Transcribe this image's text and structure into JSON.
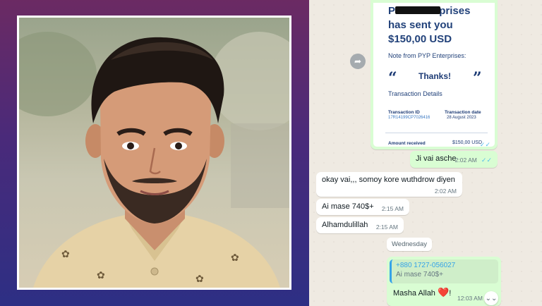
{
  "receipt": {
    "head_line1": "PYP Enterprises",
    "head_line2": "has sent you",
    "head_line3": "$150,00 USD",
    "note_label": "Note from PYP Enterprises:",
    "quote_open": "“",
    "quote_close": "”",
    "note_text": "Thanks!",
    "details_label": "Transaction Details",
    "tid_label": "Transaction ID",
    "tid_value": "17R14199CP7026416",
    "tdate_label": "Transaction date",
    "tdate_value": "28 August 2023",
    "amount_label": "Amount received",
    "amount_value": "$150,00 USD"
  },
  "messages": [
    {
      "text": "Ji vai asche",
      "time": "2:02 AM",
      "ticks": "✓✓"
    },
    {
      "text": "okay vai,,, somoy kore wuthdrow diyen",
      "time": "2:02 AM"
    },
    {
      "text": "Ai mase 740$+",
      "time": "2:15 AM"
    },
    {
      "text": "Alhamdulillah",
      "time": "2:15 AM"
    }
  ],
  "day_divider": "Wednesday",
  "reply": {
    "quoted_name": "+880 1727-056027",
    "quoted_text": "Ai mase 740$+",
    "text": "Masha Allah",
    "heart": "❤️",
    "excl": "!",
    "time": "12:03 AM"
  },
  "icons": {
    "forward": "forward-icon",
    "scroll_down": "chevron-down-icon"
  },
  "colors": {
    "outgoing_bubble": "#d9fdd3",
    "incoming_bubble": "#ffffff",
    "chat_bg": "#efeae2",
    "read_tick": "#53bdeb"
  }
}
